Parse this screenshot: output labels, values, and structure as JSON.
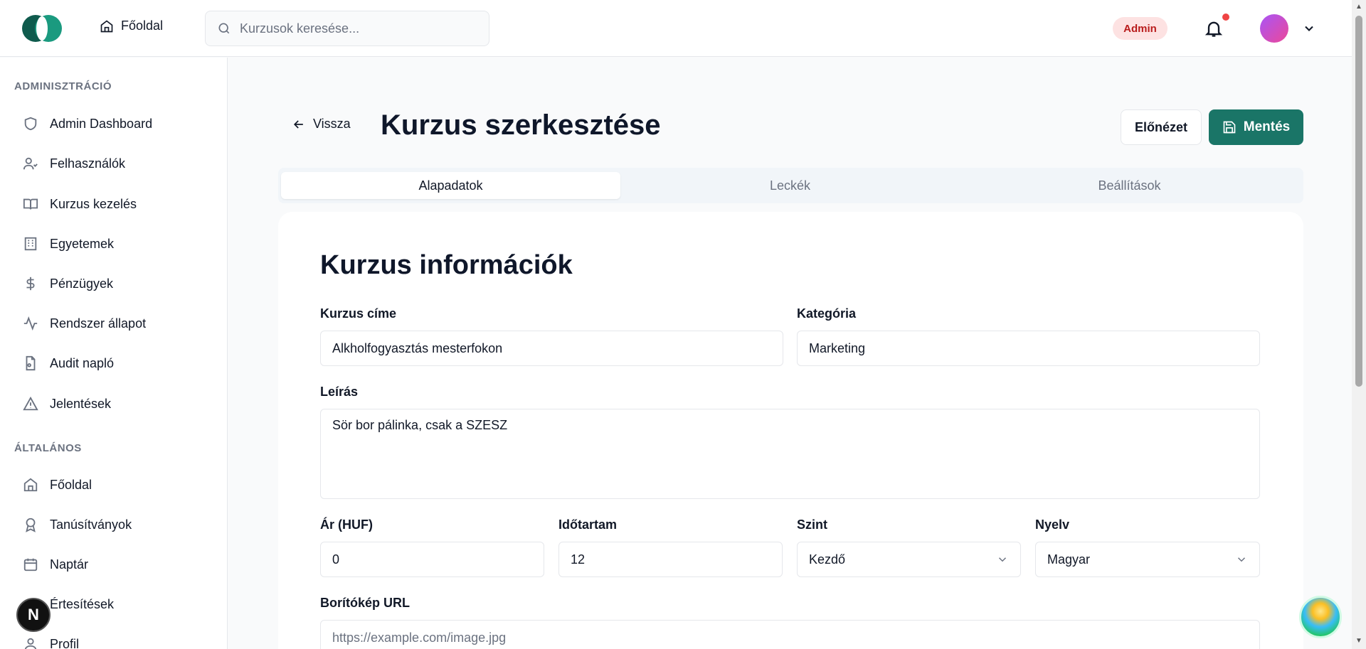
{
  "header": {
    "home_label": "Főoldal",
    "search_placeholder": "Kurzusok keresése...",
    "role_badge": "Admin"
  },
  "sidebar": {
    "admin_section": "ADMINISZTRÁCIÓ",
    "admin_items": [
      {
        "label": "Admin Dashboard",
        "icon": "shield-icon"
      },
      {
        "label": "Felhasználók",
        "icon": "users-icon"
      },
      {
        "label": "Kurzus kezelés",
        "icon": "book-icon"
      },
      {
        "label": "Egyetemek",
        "icon": "building-icon"
      },
      {
        "label": "Pénzügyek",
        "icon": "dollar-icon"
      },
      {
        "label": "Rendszer állapot",
        "icon": "activity-icon"
      },
      {
        "label": "Audit napló",
        "icon": "file-audit-icon"
      },
      {
        "label": "Jelentések",
        "icon": "alert-triangle-icon"
      }
    ],
    "general_section": "ÁLTALÁNOS",
    "general_items": [
      {
        "label": "Főoldal",
        "icon": "home-icon"
      },
      {
        "label": "Tanúsítványok",
        "icon": "award-icon"
      },
      {
        "label": "Naptár",
        "icon": "calendar-icon"
      },
      {
        "label": "Értesítések",
        "icon": "bell-icon"
      },
      {
        "label": "Profil",
        "icon": "user-icon"
      }
    ]
  },
  "page": {
    "back_label": "Vissza",
    "title": "Kurzus szerkesztése",
    "preview_label": "Előnézet",
    "save_label": "Mentés",
    "tabs": [
      "Alapadatok",
      "Leckék",
      "Beállítások"
    ],
    "active_tab": "Alapadatok"
  },
  "form": {
    "card_title": "Kurzus információk",
    "title_label": "Kurzus címe",
    "title_value": "Alkholfogyasztás mesterfokon",
    "category_label": "Kategória",
    "category_value": "Marketing",
    "description_label": "Leírás",
    "description_value": "Sör bor pálinka, csak a SZESZ",
    "price_label": "Ár (HUF)",
    "price_value": "0",
    "duration_label": "Időtartam",
    "duration_value": "12",
    "level_label": "Szint",
    "level_value": "Kezdő",
    "language_label": "Nyelv",
    "language_value": "Magyar",
    "cover_label": "Borítókép URL",
    "cover_placeholder": "https://example.com/image.jpg"
  },
  "misc": {
    "nextjs_badge": "N",
    "accent_color": "#1a7567",
    "badge_color": "#fde2e2"
  }
}
